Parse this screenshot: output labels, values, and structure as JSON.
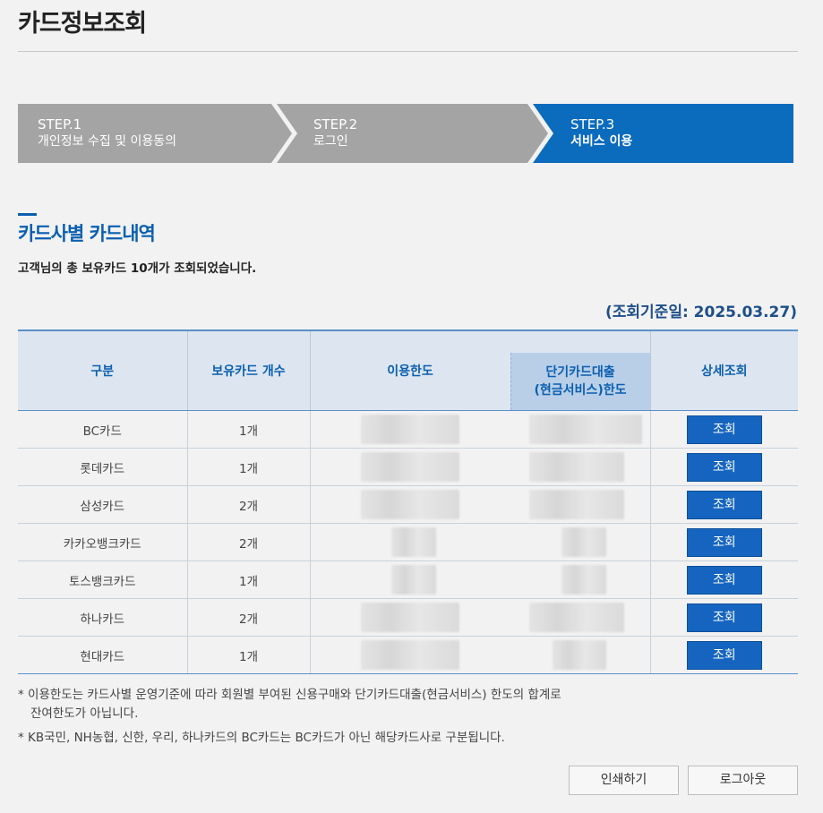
{
  "header": {
    "title": "카드정보조회"
  },
  "steps": [
    {
      "num": "STEP.1",
      "name": "개인정보 수집 및 이용동의",
      "active": false
    },
    {
      "num": "STEP.2",
      "name": "로그인",
      "active": false
    },
    {
      "num": "STEP.3",
      "name": "서비스 이용",
      "active": true
    }
  ],
  "colors": {
    "step_inactive": "#a4a4a4",
    "step_active": "#0b6bbd",
    "accent": "#0b5fb0",
    "button": "#1565c0"
  },
  "section": {
    "title": "카드사별 카드내역",
    "summary": "고객님의 총 보유카드 10개가 조회되었습니다.",
    "basis": "(조회기준일: 2025.03.27)"
  },
  "table": {
    "headers": {
      "category": "구분",
      "count": "보유카드 개수",
      "limit": "이용한도",
      "cash_limit_line1": "단기카드대출",
      "cash_limit_line2": "(현금서비스)한도",
      "detail": "상세조회"
    },
    "rows": [
      {
        "company": "BC카드",
        "count": "1개",
        "button": "조회"
      },
      {
        "company": "롯데카드",
        "count": "1개",
        "button": "조회"
      },
      {
        "company": "삼성카드",
        "count": "2개",
        "button": "조회"
      },
      {
        "company": "카카오뱅크카드",
        "count": "2개",
        "button": "조회"
      },
      {
        "company": "토스뱅크카드",
        "count": "1개",
        "button": "조회"
      },
      {
        "company": "하나카드",
        "count": "2개",
        "button": "조회"
      },
      {
        "company": "현대카드",
        "count": "1개",
        "button": "조회"
      }
    ]
  },
  "notes": {
    "note1_line1": "* 이용한도는 카드사별 운영기준에 따라 회원별 부여된 신용구매와 단기카드대출(현금서비스) 한도의 합계로",
    "note1_line2": "잔여한도가 아닙니다.",
    "note2": "* KB국민, NH농협, 신한, 우리, 하나카드의 BC카드는 BC카드가 아닌 해당카드사로 구분됩니다."
  },
  "footer": {
    "print_label": "인쇄하기",
    "logout_label": "로그아웃"
  }
}
